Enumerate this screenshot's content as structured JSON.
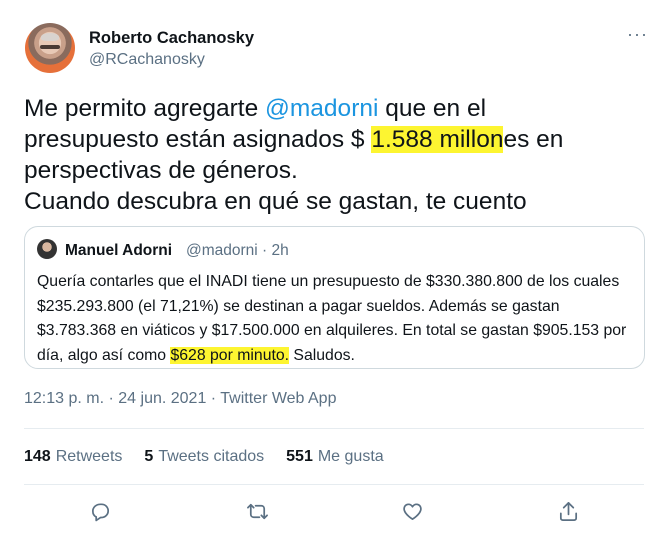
{
  "author": {
    "name": "Roberto Cachanosky",
    "handle": "@RCachanosky"
  },
  "more_icon": "···",
  "tweet": {
    "line1_a": "Me permito agregarte ",
    "line1_mention": "@madorni",
    "line1_b": " que en el",
    "line2_a": "presupuesto están asignados $ ",
    "line2_highlight": "1.588 millon",
    "line2_b": "es en",
    "line3": "perspectivas de géneros.",
    "line4": "Cuando descubra en qué se gastan, te cuento"
  },
  "quoted": {
    "name": "Manuel Adorni",
    "meta": "@madorni · 2h",
    "text_a": "Quería contarles que el INADI tiene un presupuesto de $330.380.800 de los cuales $235.293.800 (el 71,21%) se destinan a pagar sueldos. Además se gastan $3.783.368 en viáticos y $17.500.000 en alquileres. En total se gastan $905.153 por día, algo así como ",
    "text_highlight": "$628 por minuto.",
    "text_b": " Saludos."
  },
  "timestamp": "12:13 p. m. · 24 jun. 2021 · Twitter Web App",
  "stats": {
    "retweets_count": "148",
    "retweets_label": "Retweets",
    "quotes_count": "5",
    "quotes_label": "Tweets citados",
    "likes_count": "551",
    "likes_label": "Me gusta"
  },
  "actions": [
    "reply-icon",
    "retweet-icon",
    "like-icon",
    "share-icon"
  ],
  "colors": {
    "mention": "#1b95e0",
    "highlight": "#fdf531",
    "secondary_text": "#5b7083",
    "border": "#cfd9de"
  }
}
